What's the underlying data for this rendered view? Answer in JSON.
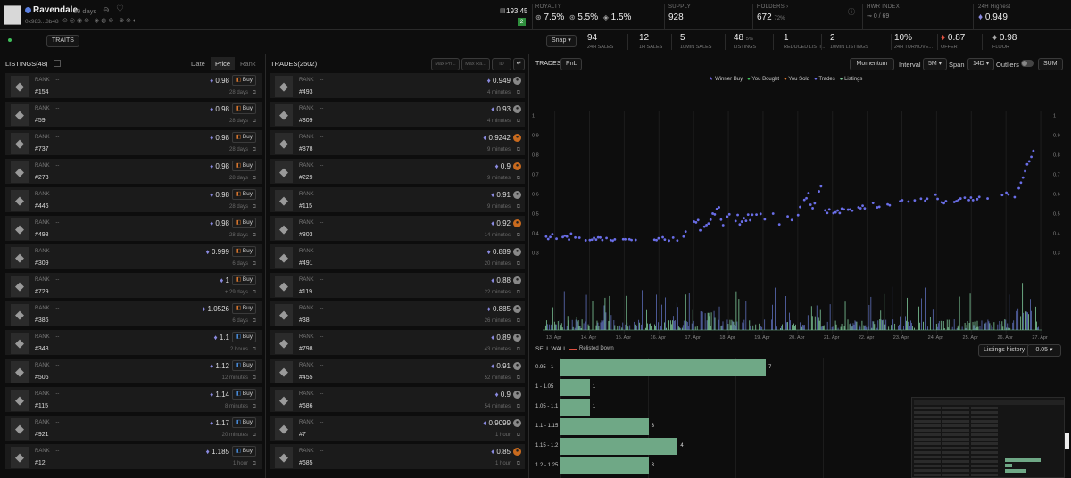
{
  "header": {
    "name": "Ravendale",
    "age": "39 days",
    "address": "0x983...8b48",
    "balance": "193.45",
    "balance_badge": "2",
    "royalty": {
      "label": "ROYALTY",
      "a": "7.5%",
      "b": "5.5%",
      "c": "1.5%"
    },
    "supply": {
      "label": "SUPPLY",
      "value": "928"
    },
    "holders": {
      "label": "HOLDERS",
      "value": "672",
      "pct": "72%"
    },
    "hwr": {
      "label": "HWR INDEX",
      "value": "0 / 69"
    },
    "high24": {
      "label": "24H Highest",
      "value": "0.949"
    }
  },
  "toolbar": {
    "traits": "TRAITS",
    "snap": "Snap",
    "stats": [
      {
        "v": "94",
        "l": "24H SALES"
      },
      {
        "v": "12",
        "l": "1H SALES"
      },
      {
        "v": "5",
        "l": "10MIN SALES"
      },
      {
        "v": "48",
        "s": "5%",
        "l": "LISTINGS"
      },
      {
        "v": "1",
        "l": "REDUCED LISTI..."
      },
      {
        "v": "2",
        "l": "10MIN LISTINGS"
      },
      {
        "v": "10%",
        "l": "24H TURNOVE..."
      },
      {
        "v": "0.87",
        "l": "OFFER"
      },
      {
        "v": "0.98",
        "l": "FLOOR"
      }
    ]
  },
  "listings": {
    "title": "LISTINGS(48)",
    "sort": [
      "Date",
      "Price",
      "Rank"
    ],
    "rank_label": "RANK",
    "dash": "--",
    "buy": "Buy",
    "rows": [
      {
        "id": "#154",
        "price": "0.98",
        "time": "28 days"
      },
      {
        "id": "#59",
        "price": "0.98",
        "time": "28 days"
      },
      {
        "id": "#737",
        "price": "0.98",
        "time": "28 days"
      },
      {
        "id": "#273",
        "price": "0.98",
        "time": "28 days"
      },
      {
        "id": "#446",
        "price": "0.98",
        "time": "28 days"
      },
      {
        "id": "#498",
        "price": "0.98",
        "time": "28 days"
      },
      {
        "id": "#309",
        "price": "0.999",
        "time": "6 days"
      },
      {
        "id": "#729",
        "price": "1",
        "time": "+ 29 days"
      },
      {
        "id": "#386",
        "price": "1.0526",
        "time": "6 days"
      },
      {
        "id": "#348",
        "price": "1.1",
        "time": "2 hours"
      },
      {
        "id": "#506",
        "price": "1.12",
        "time": "12 minutes"
      },
      {
        "id": "#115",
        "price": "1.14",
        "time": "8 minutes"
      },
      {
        "id": "#921",
        "price": "1.17",
        "time": "20 minutes"
      },
      {
        "id": "#12",
        "price": "1.185",
        "time": "1 hour"
      }
    ]
  },
  "trades": {
    "title": "TRADES(2502)",
    "max_price": "Max Pri...",
    "max_rank": "Max Ra...",
    "id_ph": "ID",
    "rank_label": "RANK",
    "dash": "--",
    "rows": [
      {
        "id": "#493",
        "price": "0.949",
        "time": "4 minutes"
      },
      {
        "id": "#809",
        "price": "0.93",
        "time": "4 minutes"
      },
      {
        "id": "#878",
        "price": "0.9242",
        "time": "9 minutes"
      },
      {
        "id": "#229",
        "price": "0.9",
        "time": "9 minutes"
      },
      {
        "id": "#115",
        "price": "0.91",
        "time": "9 minutes"
      },
      {
        "id": "#803",
        "price": "0.92",
        "time": "14 minutes"
      },
      {
        "id": "#491",
        "price": "0.889",
        "time": "20 minutes"
      },
      {
        "id": "#119",
        "price": "0.88",
        "time": "22 minutes"
      },
      {
        "id": "#38",
        "price": "0.885",
        "time": "26 minutes"
      },
      {
        "id": "#798",
        "price": "0.89",
        "time": "43 minutes"
      },
      {
        "id": "#455",
        "price": "0.91",
        "time": "52 minutes"
      },
      {
        "id": "#686",
        "price": "0.9",
        "time": "54 minutes"
      },
      {
        "id": "#7",
        "price": "0.9099",
        "time": "1 hour"
      },
      {
        "id": "#685",
        "price": "0.85",
        "time": "1 hour"
      }
    ]
  },
  "chart_panel": {
    "tab_trades": "TRADES",
    "tab_pnl": "PnL",
    "momentum": "Momentum",
    "interval_label": "Interval",
    "interval": "5M",
    "span_label": "Span",
    "span": "14D",
    "outliers": "Outliers",
    "sum": "SUM",
    "legend": [
      "Winner Buy",
      "You Bought",
      "You Sold",
      "Trades",
      "Listings"
    ],
    "colors": {
      "winner": "#6b5fd1",
      "bought": "#3fbf5a",
      "sold": "#e07a2f",
      "trades": "#6a6ee8",
      "listings": "#7fc99a"
    }
  },
  "chart_data": {
    "type": "scatter",
    "yticks": [
      0.3,
      0.4,
      0.5,
      0.6,
      0.7,
      0.8,
      0.9,
      1
    ],
    "ylim": [
      0.27,
      1.02
    ],
    "xticks": [
      "13. Apr",
      "14. Apr",
      "15. Apr",
      "16. Apr",
      "17. Apr",
      "18. Apr",
      "19. Apr",
      "20. Apr",
      "21. Apr",
      "22. Apr",
      "23. Apr",
      "24. Apr",
      "25. Apr",
      "26. Apr",
      "27. Apr"
    ],
    "xlim": [
      0,
      14.4
    ]
  },
  "sellwall": {
    "title": "SELL WALL",
    "relisted": "Relisted Down",
    "history": "Listings history",
    "step": "0.05",
    "type": "bar",
    "bins": [
      {
        "label": "0.95 - 1",
        "value": 7
      },
      {
        "label": "1 - 1.05",
        "value": 1
      },
      {
        "label": "1.05 - 1.1",
        "value": 1
      },
      {
        "label": "1.1 - 1.15",
        "value": 3
      },
      {
        "label": "1.15 - 1.2",
        "value": 4
      },
      {
        "label": "1.2 - 1.25",
        "value": 3
      }
    ]
  }
}
